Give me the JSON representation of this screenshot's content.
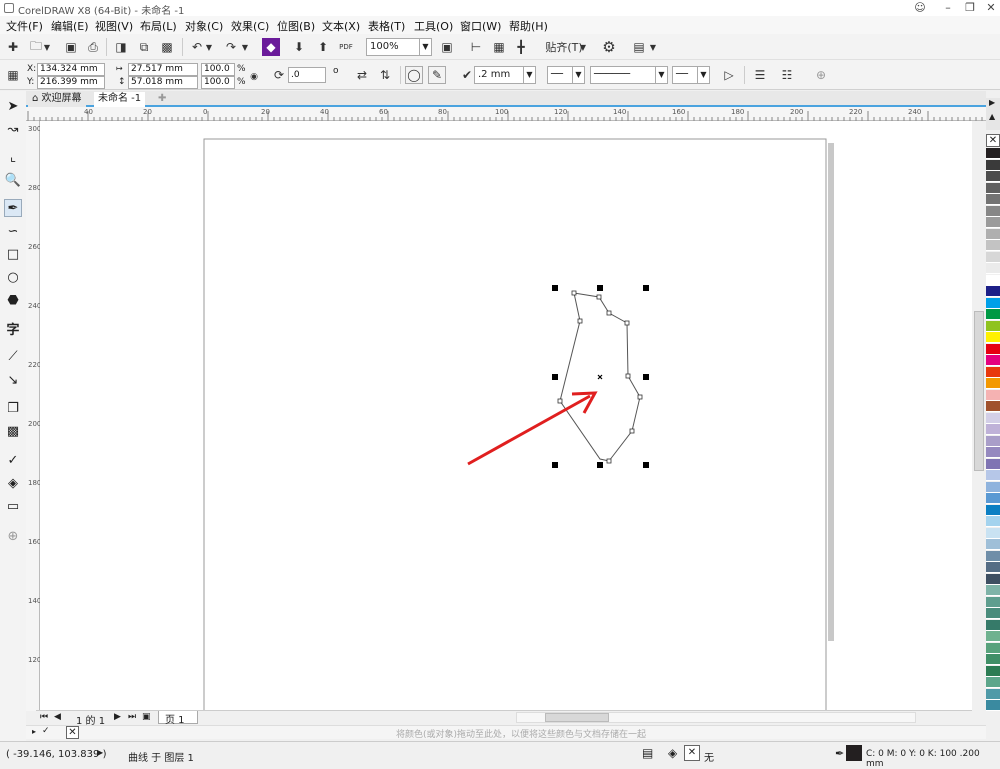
{
  "window": {
    "title": "CorelDRAW X8 (64-Bit) - 未命名 -1"
  },
  "menu": [
    "文件(F)",
    "编辑(E)",
    "视图(V)",
    "布局(L)",
    "对象(C)",
    "效果(C)",
    "位图(B)",
    "文本(X)",
    "表格(T)",
    "工具(O)",
    "窗口(W)",
    "帮助(H)"
  ],
  "toolbar": {
    "zoom": "100%",
    "snap": "贴齐(T)",
    "pdf": "PDF"
  },
  "property_bar": {
    "x_label": "X:",
    "x_value": "134.324 mm",
    "y_label": "Y:",
    "y_value": "216.399 mm",
    "w_value": "27.517 mm",
    "h_value": "57.018 mm",
    "scale_w": "100.0",
    "scale_h": "100.0",
    "pct1": "%",
    "pct2": "%",
    "angle": ".0",
    "degree": "o",
    "outline_width": ".2 mm"
  },
  "tabs": [
    "欢迎屏幕",
    "未命名 -1"
  ],
  "ruler": {
    "h_ticks": [
      "40",
      "20",
      "0",
      "20",
      "40",
      "60",
      "80",
      "100",
      "120",
      "140",
      "160",
      "180",
      "200",
      "220",
      "240"
    ],
    "v_ticks": [
      "300",
      "280",
      "260",
      "240",
      "220",
      "200",
      "180",
      "160",
      "140",
      "120"
    ]
  },
  "page_nav": {
    "page_count": "1 的 1",
    "page_tab": "页 1"
  },
  "docpalette_hint": "将颜色(或对象)拖动至此处，以便将这些颜色与文档存储在一起",
  "status": {
    "coords": "( -39.146, 103.839 )",
    "object_info": "曲线 于 图层 1",
    "fill_none": "无",
    "color_info": "C: 0 M: 0 Y: 0 K: 100  .200 mm"
  },
  "colors": {
    "accent": "#4aa3df",
    "arrow": "#e01f1f",
    "palette": [
      "#231f20",
      "#3a3a3a",
      "#4d4d4d",
      "#606060",
      "#737373",
      "#878787",
      "#9b9b9b",
      "#afafaf",
      "#c3c3c3",
      "#d7d7d7",
      "#ebebeb",
      "#ffffff",
      "#1d2088",
      "#00a0e9",
      "#009944",
      "#8fc31f",
      "#fff100",
      "#e60012",
      "#e4007f",
      "#e8380d",
      "#f39800",
      "#f5b2b2",
      "#a0522d",
      "#d3cfe7",
      "#bfb2d8",
      "#a99ec9",
      "#9589bf",
      "#7f74b3",
      "#b6c7e8",
      "#8fb3dd",
      "#5a99d3",
      "#0b7fc3",
      "#a4d3ee",
      "#c9e2f2",
      "#9fbfd8",
      "#6f8ea8",
      "#556d85",
      "#3e4f62",
      "#7fb3a8",
      "#5f9e8f",
      "#4a8c7c",
      "#367a69",
      "#6fb28f",
      "#58a27c",
      "#408f67",
      "#2c7c54",
      "#5da68b",
      "#4f9aa8",
      "#3a8aa0"
    ]
  }
}
